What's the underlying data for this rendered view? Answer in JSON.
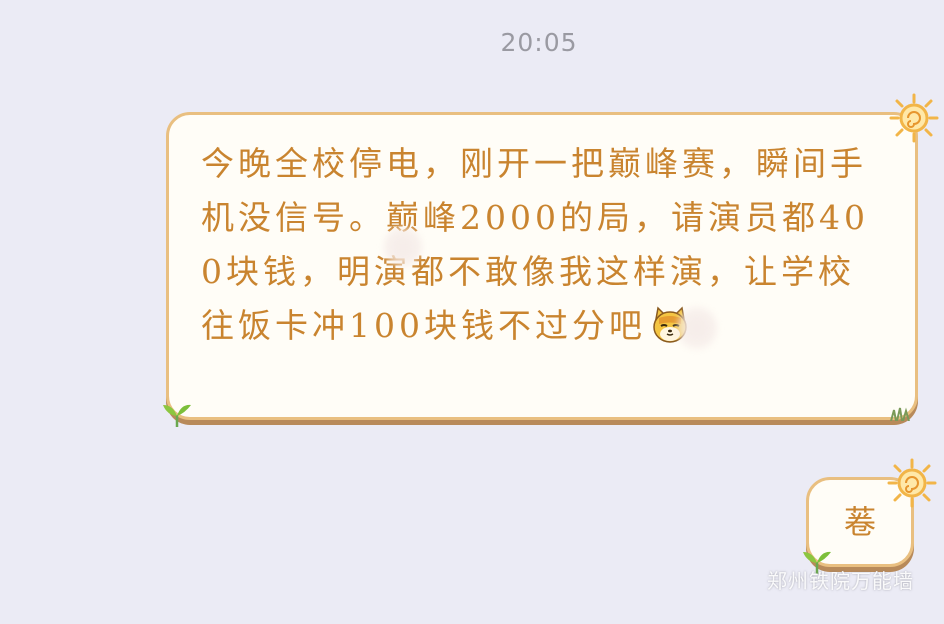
{
  "chat": {
    "timestamp": "20:05",
    "messages": [
      {
        "text": "今晚全校停电，刚开一把巅峰赛，瞬间手机没信号。巅峰2000的局，请演员都400块钱，明演都不敢像我这样演，让学校往饭卡冲100块钱不过分吧",
        "emoji": "cat-face"
      },
      {
        "text": "菤"
      }
    ]
  },
  "watermark": "郑州铁院万能墙",
  "colors": {
    "background": "#ebebf5",
    "bubble_fill": "#fffdf7",
    "bubble_border": "#e9bf80",
    "text": "#c9842f",
    "timestamp": "#9a9aa2"
  }
}
